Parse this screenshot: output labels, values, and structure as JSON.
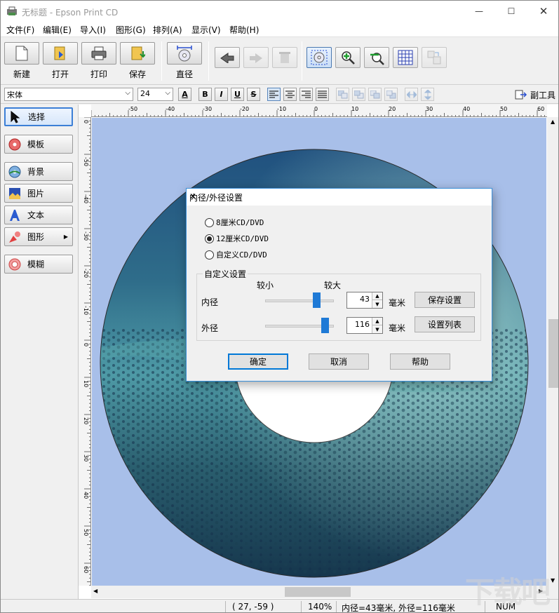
{
  "window": {
    "title": "无标题 - Epson Print CD",
    "minimize": "—",
    "maximize": "☐",
    "close": "✕"
  },
  "menu": [
    "文件(F)",
    "编辑(E)",
    "导入(I)",
    "图形(G)",
    "排列(A)",
    "显示(V)",
    "帮助(H)"
  ],
  "toolbar": {
    "new": "新建",
    "open": "打开",
    "print": "打印",
    "save": "保存",
    "diameter": "直径"
  },
  "format": {
    "font": "宋体",
    "size": "24",
    "bold": "B",
    "italic": "I",
    "underline": "U",
    "strike": "S",
    "subtool": "副工具"
  },
  "tools": {
    "select": "选择",
    "template": "模板",
    "background": "背景",
    "image": "图片",
    "text": "文本",
    "shape": "图形",
    "blur": "模糊"
  },
  "ruler": {
    "h_labels": [
      "-50",
      "-40",
      "-30",
      "-20",
      "-10",
      "0",
      "10",
      "20",
      "30",
      "40",
      "50",
      "60"
    ],
    "v_labels": [
      "0",
      "-50",
      "-40",
      "-30",
      "-20",
      "-10",
      "0",
      "10",
      "20",
      "30",
      "40",
      "50",
      "60"
    ]
  },
  "dialog": {
    "title": "内径/外径设置",
    "options": [
      "8厘米CD/DVD",
      "12厘米CD/DVD",
      "自定义CD/DVD"
    ],
    "selected": 1,
    "group_label": "自定义设置",
    "smaller": "较小",
    "larger": "较大",
    "inner_label": "内径",
    "outer_label": "外径",
    "inner_value": "43",
    "outer_value": "116",
    "inner_level": 0.75,
    "outer_level": 0.87,
    "unit": "毫米",
    "save_btn": "保存设置",
    "list_btn": "设置列表",
    "ok": "确定",
    "cancel": "取消",
    "help": "帮助"
  },
  "status": {
    "coords": "(   27, -59 )",
    "zoom": "140%",
    "info": "内径=43毫米, 外径=116毫米",
    "num": "NUM"
  },
  "watermark": "下载吧",
  "colors": {
    "canvas": "#a8bfe9",
    "accent": "#1f7ad6",
    "dialog_border": "#3a8fd9"
  }
}
